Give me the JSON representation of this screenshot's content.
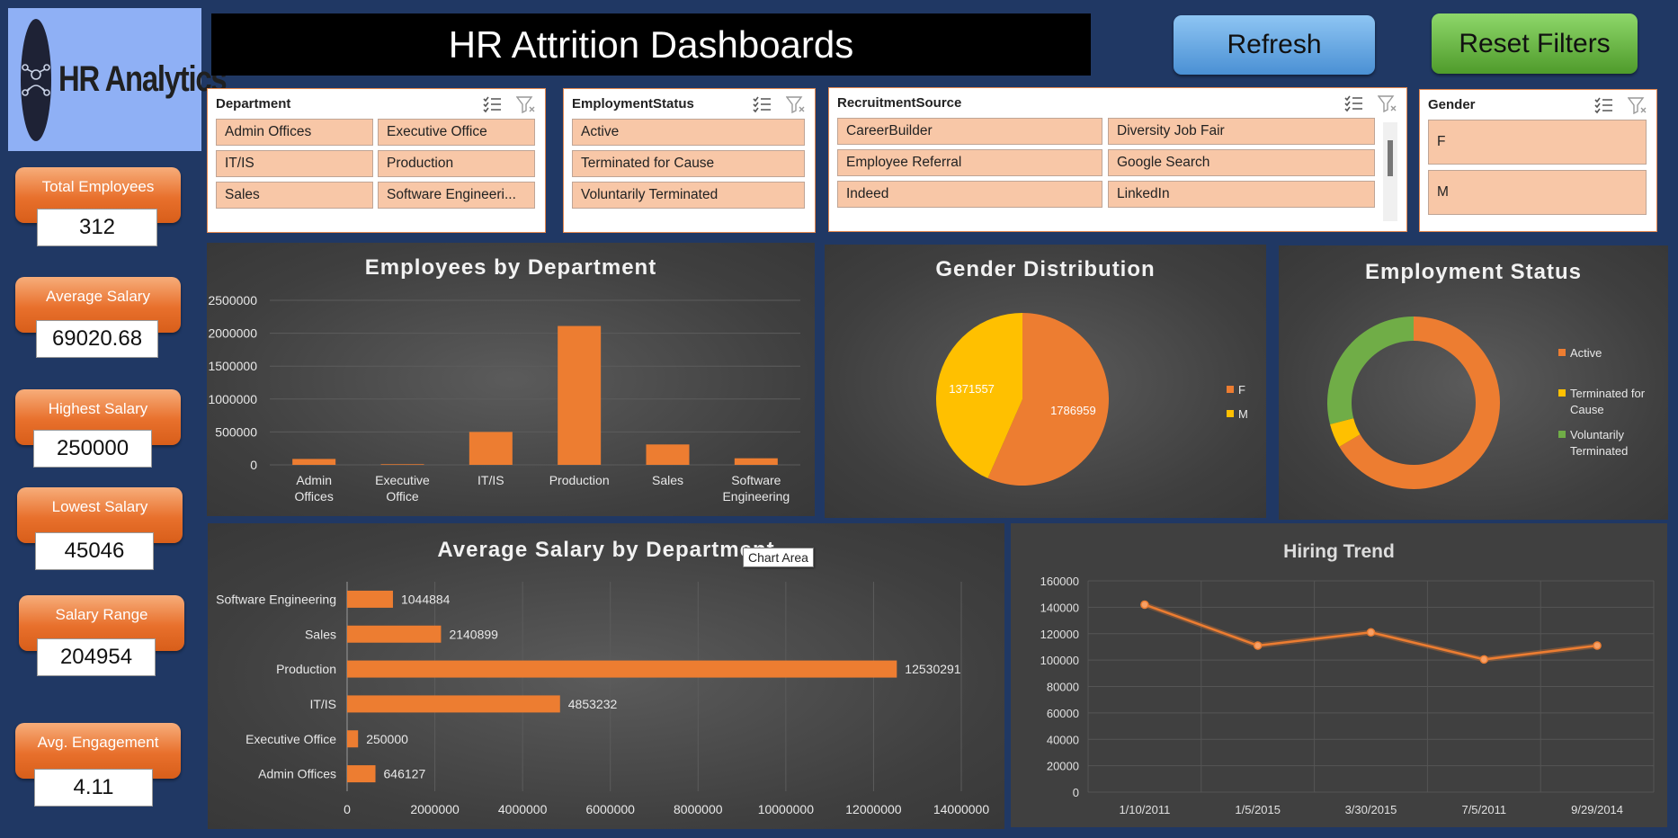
{
  "logo": {
    "text": "HR Analytics",
    "icon": "network-person-icon"
  },
  "title": "HR Attrition Dashboards",
  "buttons": {
    "refresh": "Refresh",
    "reset": "Reset Filters"
  },
  "kpis": [
    {
      "label": "Total Employees",
      "value": "312"
    },
    {
      "label": "Average Salary",
      "value": "69020.68"
    },
    {
      "label": "Highest Salary",
      "value": "250000"
    },
    {
      "label": "Lowest Salary",
      "value": "45046"
    },
    {
      "label": "Salary Range",
      "value": "204954"
    },
    {
      "label": "Avg. Engagement",
      "value": "4.11"
    }
  ],
  "slicers": {
    "department": {
      "title": "Department",
      "items": [
        "Admin Offices",
        "Executive Office",
        "IT/IS",
        "Production",
        "Sales",
        "Software Engineeri..."
      ]
    },
    "employment_status": {
      "title": "EmploymentStatus",
      "items": [
        "Active",
        "Terminated for Cause",
        "Voluntarily Terminated"
      ]
    },
    "recruitment_source": {
      "title": "RecruitmentSource",
      "items": [
        "CareerBuilder",
        "Diversity Job Fair",
        "Employee Referral",
        "Google Search",
        "Indeed",
        "LinkedIn"
      ]
    },
    "gender": {
      "title": "Gender",
      "items": [
        "F",
        "M"
      ]
    }
  },
  "tooltip": "Chart Area",
  "colors": {
    "orange": "#ed7d31",
    "yellow": "#ffc000",
    "green": "#70ad47",
    "background": "#203864"
  },
  "chart_data": [
    {
      "type": "bar",
      "title": "Employees by Department",
      "categories": [
        "Admin Offices",
        "Executive Office",
        "IT/IS",
        "Production",
        "Sales",
        "Software Engineering"
      ],
      "values": [
        90000,
        10000,
        500000,
        2110000,
        310000,
        100000
      ],
      "yticks": [
        "0",
        "500000",
        "1000000",
        "1500000",
        "2000000",
        "2500000"
      ],
      "ylim": [
        0,
        2500000
      ],
      "grid": true
    },
    {
      "type": "pie",
      "title": "Gender Distribution",
      "labels": [
        "F",
        "M"
      ],
      "values": [
        1786959,
        1371557
      ],
      "data_labels": [
        "1786959",
        "1371557"
      ],
      "legend": "right"
    },
    {
      "type": "pie",
      "subtype": "donut",
      "title": "Employment Status",
      "labels": [
        "Active",
        "Terminated for Cause",
        "Voluntarily Terminated"
      ],
      "values": [
        66.5,
        4.5,
        29
      ],
      "legend": "right"
    },
    {
      "type": "bar",
      "orientation": "horizontal",
      "title": "Average Salary by Department",
      "categories": [
        "Software Engineering",
        "Sales",
        "Production",
        "IT/IS",
        "Executive Office",
        "Admin Offices"
      ],
      "values": [
        1044884,
        2140899,
        12530291,
        4853232,
        250000,
        646127
      ],
      "data_labels": [
        "1044884",
        "2140899",
        "12530291",
        "4853232",
        "250000",
        "646127"
      ],
      "xticks": [
        "0",
        "2000000",
        "4000000",
        "6000000",
        "8000000",
        "10000000",
        "12000000",
        "14000000"
      ],
      "xlim": [
        0,
        14000000
      ],
      "grid": true
    },
    {
      "type": "line",
      "title": "Hiring Trend",
      "x": [
        "1/10/2011",
        "1/5/2015",
        "3/30/2015",
        "7/5/2011",
        "9/29/2014"
      ],
      "values": [
        142000,
        111000,
        121000,
        100500,
        111000
      ],
      "yticks": [
        "0",
        "20000",
        "40000",
        "60000",
        "80000",
        "100000",
        "120000",
        "140000",
        "160000"
      ],
      "ylim": [
        0,
        160000
      ],
      "grid": true
    }
  ]
}
